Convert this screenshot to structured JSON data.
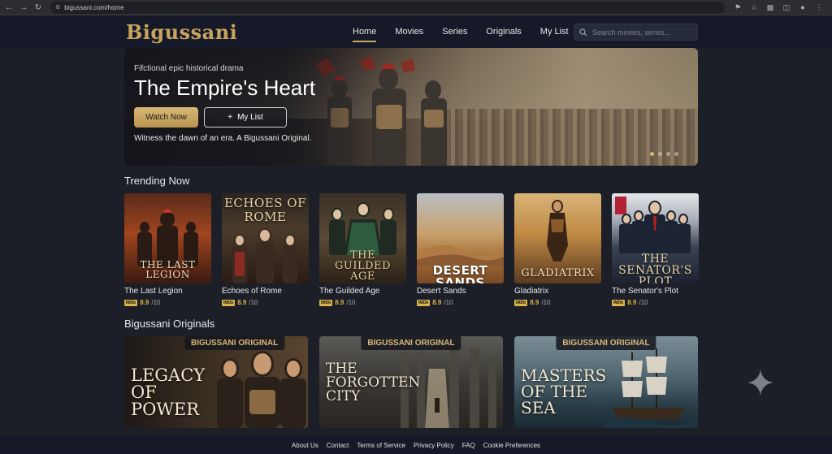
{
  "browser": {
    "url": "bigussani.com/home"
  },
  "header": {
    "logo": "Bigussani",
    "nav": [
      {
        "label": "Home",
        "active": true
      },
      {
        "label": "Movies",
        "active": false
      },
      {
        "label": "Series",
        "active": false
      },
      {
        "label": "Originals",
        "active": false
      },
      {
        "label": "My List",
        "active": false
      }
    ],
    "search_placeholder": "Search movies, series..."
  },
  "hero": {
    "subtitle": "Fifctional epic historical drama",
    "title": "The Empire's Heart",
    "watch_label": "Watch Now",
    "mylist_label": "My List",
    "tagline": "Witness the dawn of an era. A Bigussani Original.",
    "active_slide": 1,
    "slide_count": 4
  },
  "trending": {
    "title": "Trending Now",
    "items": [
      {
        "name": "The Last Legion",
        "poster": "THE LAST LEGION",
        "score": "8.9",
        "out": "/10",
        "imdb": "IMDb"
      },
      {
        "name": "Echoes of Rome",
        "poster": "ECHOES OF ROME",
        "score": "8.9",
        "out": "/10",
        "imdb": "IMDb"
      },
      {
        "name": "The Guilded Age",
        "poster": "THE GUILDED AGE",
        "score": "8.9",
        "out": "/10",
        "imdb": "IMDb"
      },
      {
        "name": "Desert Sands",
        "poster": "DESERT SANDS",
        "score": "8.9",
        "out": "/10",
        "imdb": "IMDb"
      },
      {
        "name": "Gladiatrix",
        "poster": "GLADIATRIX",
        "score": "8.9",
        "out": "/10",
        "imdb": "IMDb"
      },
      {
        "name": "The Senator's Plot",
        "poster": "THE SENATOR'S PLOT",
        "score": "8.9",
        "out": "/10",
        "imdb": "IMDb"
      }
    ]
  },
  "originals": {
    "title": "Bigussani Originals",
    "items": [
      {
        "badge": "BIGUSSANI ORIGINAL",
        "poster": "LEGACY OF POWER"
      },
      {
        "badge": "BIGUSSANI ORIGINAL",
        "poster": "THE FORGOTTEN CITY"
      },
      {
        "badge": "BIGUSSANI ORIGINAL",
        "poster": "MASTERS OF THE SEA"
      }
    ]
  },
  "footer": {
    "links": [
      "About Us",
      "Contact",
      "Terms of Service",
      "Privacy Policy",
      "FAQ",
      "Cookie Preferences"
    ]
  },
  "colors": {
    "gold": "#c9a45c",
    "background": "#1c1f27",
    "header": "#161a28"
  }
}
